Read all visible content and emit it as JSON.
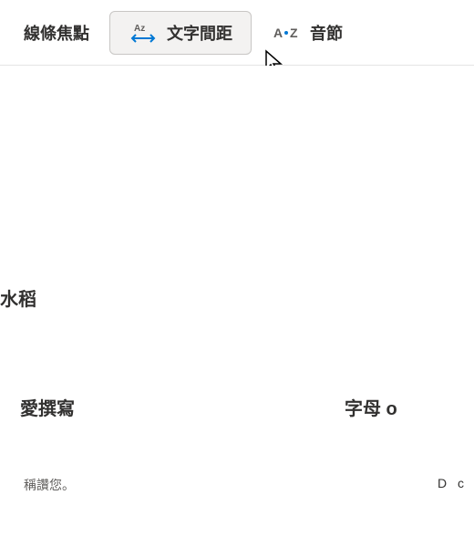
{
  "toolbar": {
    "lineFocus": {
      "label": "線條焦點"
    },
    "textSpacing": {
      "label": "文字間距"
    },
    "syllables": {
      "label": "音節"
    }
  },
  "content": {
    "word1": "水稻",
    "word2": "愛撰寫",
    "word3": "字母 o",
    "praise": "稱讚您。",
    "rightText": "D c"
  },
  "colors": {
    "accent": "#0078d4",
    "iconGray": "#605e5c"
  }
}
